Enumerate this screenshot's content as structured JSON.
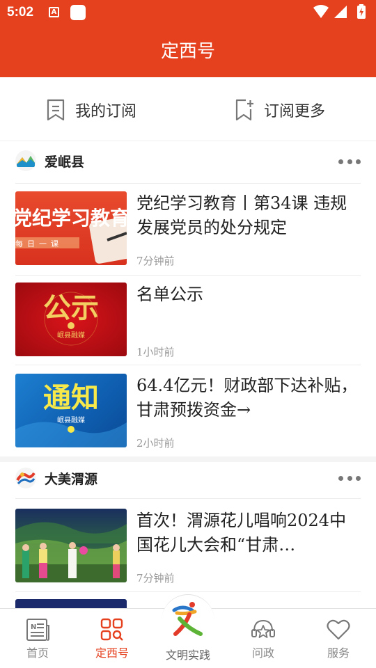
{
  "status_bar": {
    "time": "5:02",
    "notification_letter": "A"
  },
  "header": {
    "title": "定西号"
  },
  "subscription": {
    "my_label": "我的订阅",
    "more_label": "订阅更多"
  },
  "sections": [
    {
      "name": "爱岷县",
      "articles": [
        {
          "title": "党纪学习教育丨第34课 违规发展党员的处分规定",
          "time": "7分钟前",
          "thumb_text": "党纪学习教育",
          "thumb_sub": "每日一课"
        },
        {
          "title": "名单公示",
          "time": "1小时前",
          "thumb_text": "公示",
          "thumb_sub": "岷县融媒"
        },
        {
          "title": "64.4亿元！财政部下达补贴，甘肃预拨资金→",
          "time": "2小时前",
          "thumb_text": "通知",
          "thumb_sub": "岷县融媒"
        }
      ]
    },
    {
      "name": "大美渭源",
      "articles": [
        {
          "title": "首次！渭源花儿唱响2024中国花儿大会和“甘肃…",
          "time": "7分钟前"
        }
      ]
    }
  ],
  "tabbar": {
    "home": "首页",
    "dingxihao": "定西号",
    "wenming": "文明实践",
    "wenzheng": "问政",
    "fuwu": "服务"
  },
  "colors": {
    "brand": "#e5411f",
    "text": "#222222",
    "muted": "#999999"
  }
}
